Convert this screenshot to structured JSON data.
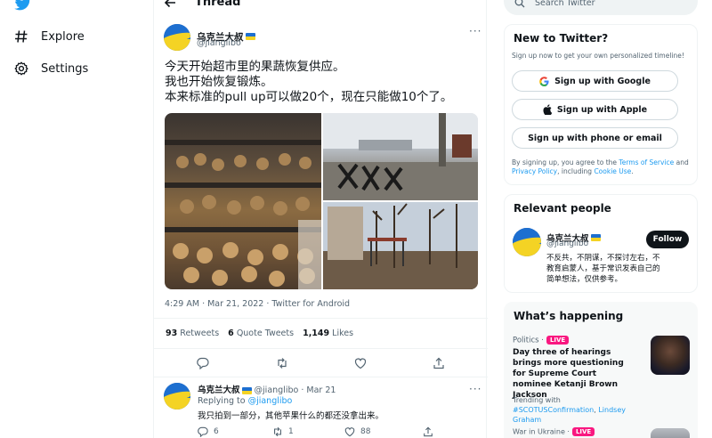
{
  "nav": {
    "items": [
      {
        "label": "Explore",
        "icon": "hash-icon"
      },
      {
        "label": "Settings",
        "icon": "gear-icon"
      }
    ]
  },
  "thread": {
    "title": "Thread",
    "main_tweet": {
      "name": "乌克兰大叔",
      "handle": "@jianglibo",
      "text_lines": [
        "今天开始超市里的果蔬恢复供应。",
        "我也开始恢复锻炼。",
        "本来标准的pull up可以做20个，现在只能做10个了。"
      ],
      "timestamp": "4:29 AM · Mar 21, 2022 · Twitter for Android",
      "retweets_count": "93",
      "retweets_label": "Retweets",
      "quote_count": "6",
      "quote_label": "Quote Tweets",
      "likes_count": "1,149",
      "likes_label": "Likes",
      "more": "···"
    },
    "reply": {
      "name": "乌克兰大叔",
      "handle": "@jianglibo",
      "date": "· Mar 21",
      "replying_prefix": "Replying to ",
      "replying_to": "@jianglibo",
      "text": "我只拍到一部分，其他苹果什么的都还没拿出来。",
      "replies": "6",
      "retweets": "1",
      "likes": "88",
      "more": "···"
    }
  },
  "sidebar": {
    "search_placeholder": "Search Twitter",
    "new_to_twitter": {
      "title": "New to Twitter?",
      "subtitle": "Sign up now to get your own personalized timeline!",
      "google": "Sign up with Google",
      "apple": "Sign up with Apple",
      "phone": "Sign up with phone or email",
      "terms_prefix": "By signing up, you agree to the ",
      "terms": "Terms of Service",
      "and": " and",
      "privacy": "Privacy Policy",
      "including": ", including ",
      "cookie": "Cookie Use",
      "period": "."
    },
    "relevant_people": {
      "title": "Relevant people",
      "name": "乌克兰大叔",
      "handle": "@jianglibo",
      "follow": "Follow",
      "bio": "不反共，不阴谋，不探讨左右，不教育启蒙人，基于常识发表自己的简单想法，仅供参考。"
    },
    "whats_happening": {
      "title": "What’s happening",
      "category": "Politics ·",
      "live": "LIVE",
      "headline": "Day three of hearings brings more questioning for Supreme Court nominee Ketanji Brown Jackson",
      "trending_prefix": "Trending with ",
      "trending_tag": "#SCOTUSConfirmation",
      "trending_sep": ",",
      "trending_name": "Lindsey Graham",
      "next_category": "War in Ukraine ·",
      "next_live": "LIVE"
    }
  }
}
